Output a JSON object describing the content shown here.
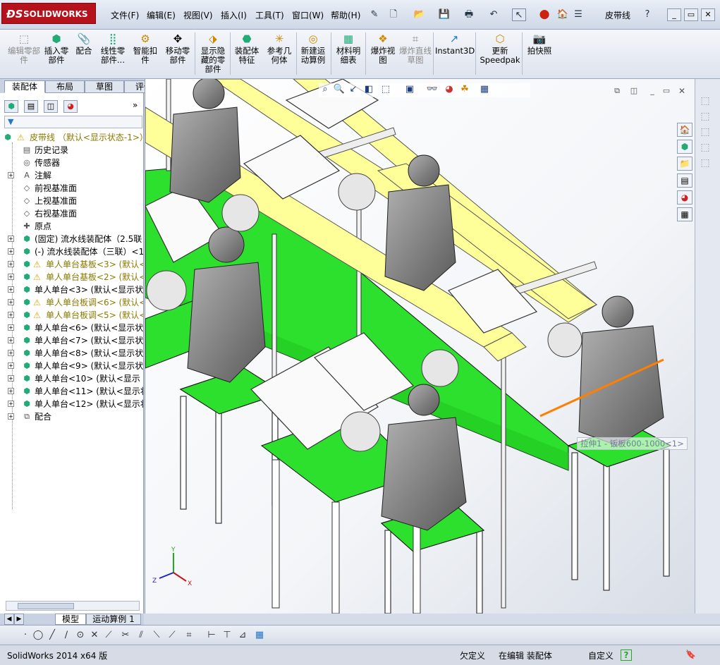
{
  "app": {
    "logo_text": "SOLIDWORKS",
    "title": "皮带线"
  },
  "menus": [
    "文件(F)",
    "编辑(E)",
    "视图(V)",
    "插入(I)",
    "工具(T)",
    "窗口(W)",
    "帮助(H)"
  ],
  "ribbon": [
    {
      "label": "编辑零部件",
      "icon": "edit-component-icon",
      "disabled": true
    },
    {
      "label": "插入零部件",
      "icon": "insert-component-icon",
      "disabled": false
    },
    {
      "label": "配合",
      "icon": "mate-icon",
      "disabled": false
    },
    {
      "label": "线性零部件...",
      "icon": "linear-pattern-icon",
      "disabled": false
    },
    {
      "label": "智能扣件",
      "icon": "smart-fastener-icon",
      "disabled": false
    },
    {
      "label": "移动零部件",
      "icon": "move-component-icon",
      "disabled": false
    },
    {
      "label": "显示隐藏的零部件",
      "icon": "show-hidden-icon",
      "disabled": false
    },
    {
      "label": "装配体特征",
      "icon": "assembly-feature-icon",
      "disabled": false
    },
    {
      "label": "参考几何体",
      "icon": "reference-geometry-icon",
      "disabled": false
    },
    {
      "label": "新建运动算例",
      "icon": "motion-study-icon",
      "disabled": false
    },
    {
      "label": "材料明细表",
      "icon": "bom-icon",
      "disabled": false
    },
    {
      "label": "爆炸视图",
      "icon": "explode-icon",
      "disabled": false
    },
    {
      "label": "爆炸直线草图",
      "icon": "explode-line-icon",
      "disabled": true
    },
    {
      "label": "Instant3D",
      "icon": "instant3d-icon",
      "disabled": false
    },
    {
      "label": "更新Speedpak",
      "icon": "speedpak-icon",
      "disabled": false
    },
    {
      "label": "拍快照",
      "icon": "snapshot-icon",
      "disabled": false
    }
  ],
  "left_tabs": [
    "装配体",
    "布局",
    "草图",
    "评估"
  ],
  "tree": {
    "root": "皮带线 （默认<显示状态-1>）",
    "items": [
      {
        "label": "历史记录",
        "icon": "history-icon",
        "warn": false,
        "olive": false,
        "expand": false
      },
      {
        "label": "传感器",
        "icon": "sensor-icon",
        "warn": false,
        "olive": false,
        "expand": false
      },
      {
        "label": "注解",
        "icon": "annotation-icon",
        "warn": false,
        "olive": false,
        "expand": true
      },
      {
        "label": "前视基准面",
        "icon": "plane-icon",
        "warn": false,
        "olive": false,
        "expand": false
      },
      {
        "label": "上视基准面",
        "icon": "plane-icon",
        "warn": false,
        "olive": false,
        "expand": false
      },
      {
        "label": "右视基准面",
        "icon": "plane-icon",
        "warn": false,
        "olive": false,
        "expand": false
      },
      {
        "label": "原点",
        "icon": "origin-icon",
        "warn": false,
        "olive": false,
        "expand": false
      },
      {
        "label": "(固定) 流水线装配体（2.5联",
        "icon": "assembly-icon",
        "warn": false,
        "olive": false,
        "expand": true
      },
      {
        "label": "(-) 流水线装配体（三联）<1",
        "icon": "assembly-icon",
        "warn": false,
        "olive": false,
        "expand": true
      },
      {
        "label": "单人单台基板<3> (默认<",
        "icon": "assembly-icon",
        "warn": true,
        "olive": true,
        "expand": true
      },
      {
        "label": "单人单台基板<2> (默认<",
        "icon": "assembly-icon",
        "warn": true,
        "olive": true,
        "expand": true
      },
      {
        "label": "单人单台<3> (默认<显示状",
        "icon": "assembly-icon",
        "warn": false,
        "olive": false,
        "expand": true
      },
      {
        "label": "单人单台板调<6> (默认<",
        "icon": "assembly-icon",
        "warn": true,
        "olive": true,
        "expand": true
      },
      {
        "label": "单人单台板调<5> (默认<",
        "icon": "assembly-icon",
        "warn": true,
        "olive": true,
        "expand": true
      },
      {
        "label": "单人单台<6> (默认<显示状",
        "icon": "assembly-icon",
        "warn": false,
        "olive": false,
        "expand": true
      },
      {
        "label": "单人单台<7> (默认<显示状",
        "icon": "assembly-icon",
        "warn": false,
        "olive": false,
        "expand": true
      },
      {
        "label": "单人单台<8> (默认<显示状",
        "icon": "assembly-icon",
        "warn": false,
        "olive": false,
        "expand": true
      },
      {
        "label": "单人单台<9> (默认<显示状",
        "icon": "assembly-icon",
        "warn": false,
        "olive": false,
        "expand": true
      },
      {
        "label": "单人单台<10> (默认<显示",
        "icon": "assembly-icon",
        "warn": false,
        "olive": false,
        "expand": true
      },
      {
        "label": "单人单台<11> (默认<显示状",
        "icon": "assembly-icon",
        "warn": false,
        "olive": false,
        "expand": true
      },
      {
        "label": "单人单台<12> (默认<显示状",
        "icon": "assembly-icon",
        "warn": false,
        "olive": false,
        "expand": true
      },
      {
        "label": "配合",
        "icon": "mates-folder-icon",
        "warn": false,
        "olive": false,
        "expand": true
      }
    ]
  },
  "doc_tabs": [
    "模型",
    "运动算例 1"
  ],
  "viewport": {
    "tooltip": "拉伸1 - 钣板600-1000<1>"
  },
  "status": {
    "version": "SolidWorks 2014 x64 版",
    "definition": "欠定义",
    "mode": "在编辑 装配体",
    "units": "自定义"
  }
}
